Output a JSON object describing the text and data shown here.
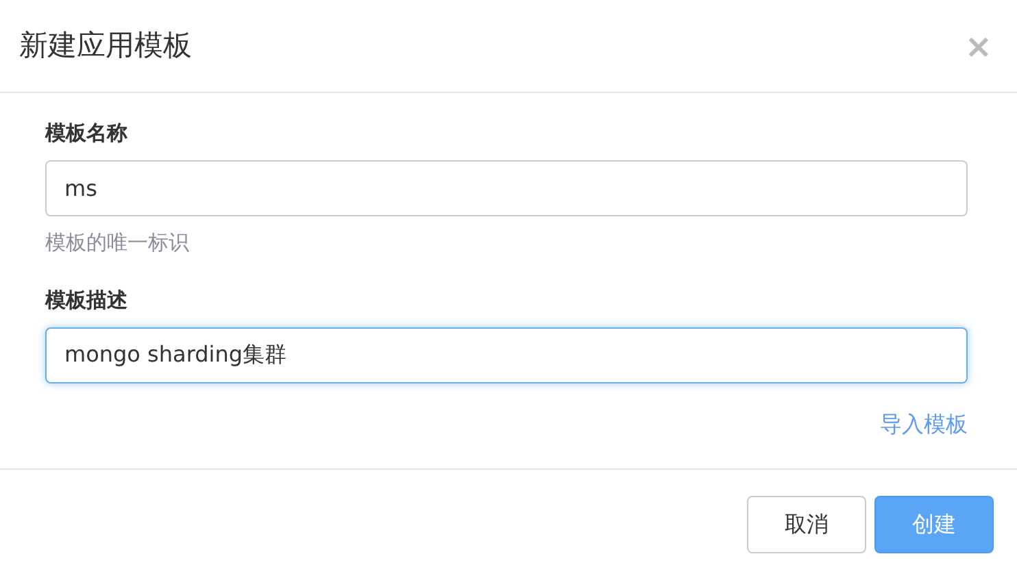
{
  "dialog": {
    "title": "新建应用模板",
    "close": "×"
  },
  "fields": [
    {
      "label": "模板名称",
      "value": "ms",
      "help": "模板的唯一标识",
      "focused": false
    },
    {
      "label": "模板描述",
      "value": "mongo sharding集群",
      "focused": true
    }
  ],
  "import_link": "导入模板",
  "buttons": [
    {
      "label": "取消",
      "kind": "secondary"
    },
    {
      "label": "创建",
      "kind": "primary"
    }
  ]
}
